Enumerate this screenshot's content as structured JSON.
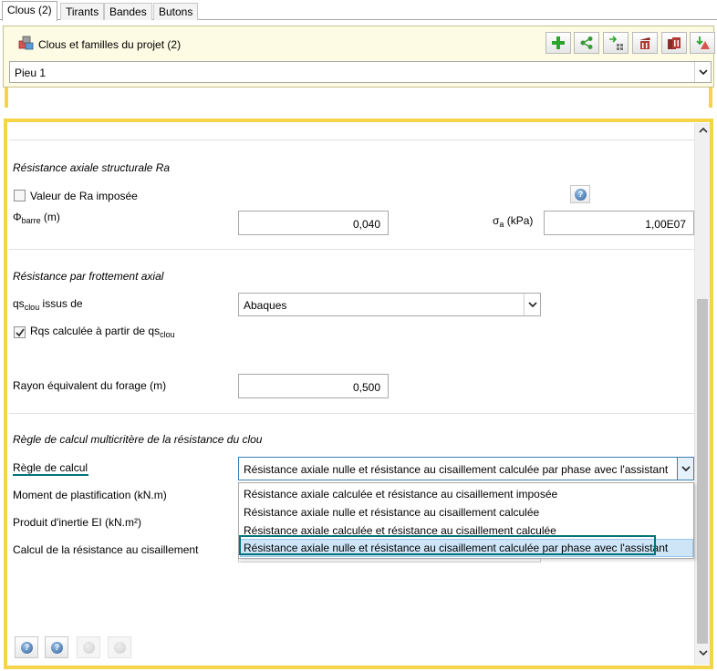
{
  "tabs": [
    "Clous (2)",
    "Tirants",
    "Bandes",
    "Butons"
  ],
  "project": {
    "title": "Clous et familles du projet (2)",
    "selected": "Pieu 1",
    "toolbar_icons": [
      "add-icon",
      "share-icon",
      "import-export-icon",
      "delete-icon",
      "delete-family-icon",
      "export-icon"
    ]
  },
  "sections": {
    "axial_structural": {
      "title": "Résistance axiale structurale Ra",
      "checkbox_label": "Valeur de Ra imposée",
      "phi_label": "Φ",
      "phi_sub": "barre",
      "phi_unit": " (m)",
      "phi_value": "0,040",
      "sigma_label": "σ",
      "sigma_sub": "a",
      "sigma_unit": " (kPa)",
      "sigma_value": "1,00E07"
    },
    "friction": {
      "title": "Résistance par frottement axial",
      "qs_label": "qs",
      "qs_sub": "clou",
      "qs_suffix": " issus de",
      "qs_value": "Abaques",
      "rqs_label": "Rqs calculée à partir de qs",
      "rqs_sub": "clou",
      "radius_label": "Rayon équivalent du forage (m)",
      "radius_value": "0,500"
    },
    "rule": {
      "title": "Règle de calcul multicritère de la résistance du clou",
      "rule_label": "Règle de calcul",
      "rule_value": "Résistance axiale nulle et résistance au cisaillement calculée par phase avec l'assistant",
      "moment_label": "Moment de plastification (kN.m)",
      "inertia_label": "Produit d'inertie EI (kN.m²)",
      "shear_label": "Calcul de la résistance au cisaillement",
      "options": [
        "Résistance axiale calculée et résistance au cisaillement imposée",
        "Résistance axiale nulle et résistance au cisaillement calculée",
        "Résistance axiale calculée et résistance au cisaillement calculée",
        "Résistance axiale nulle et résistance au cisaillement calculée par phase avec l'assistant"
      ]
    }
  },
  "colors": {
    "accent_yellow": "#f5d44a",
    "highlight_teal": "#00747a",
    "selection_blue": "#cde5f7"
  }
}
